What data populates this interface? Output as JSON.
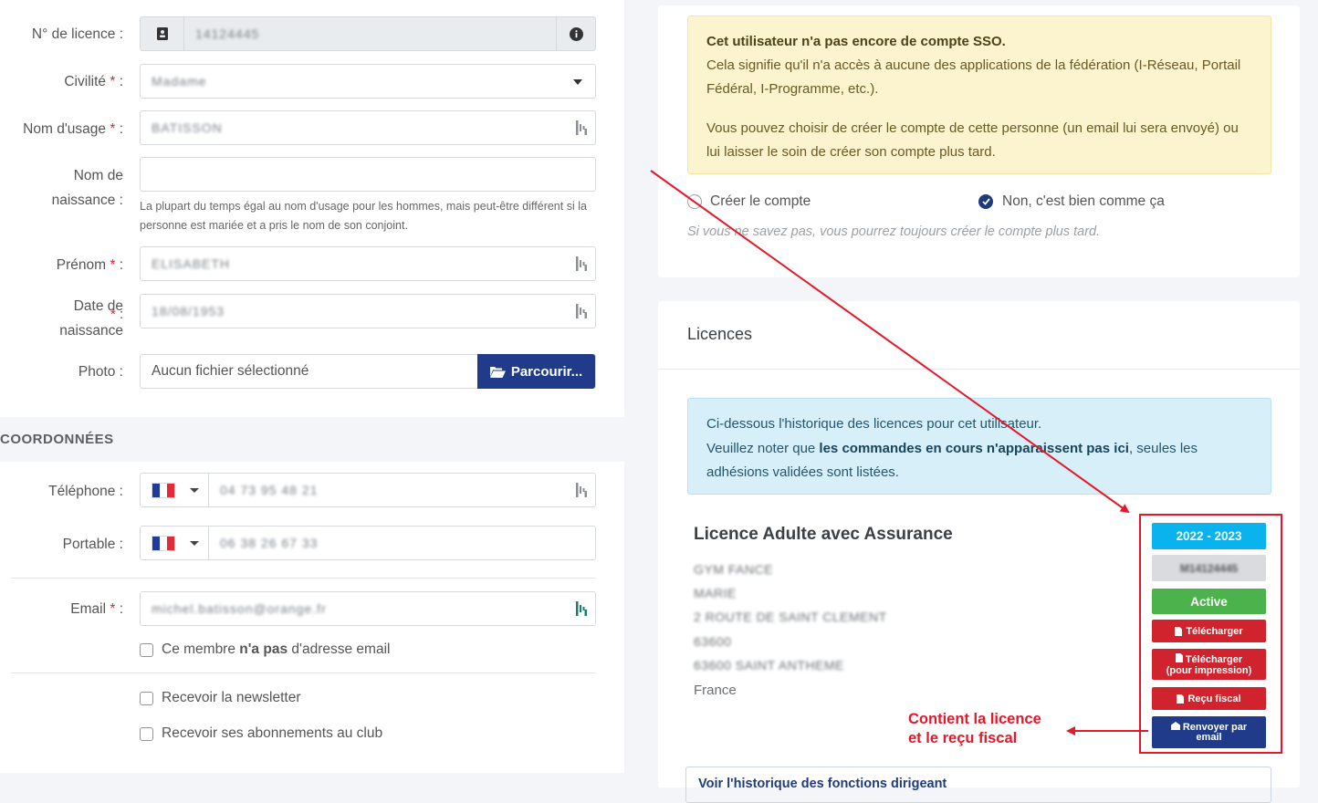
{
  "form": {
    "licence_label": "N° de licence :",
    "licence_value": "14124445",
    "civility_label": "Civilité",
    "civility_value": "Madame",
    "usage_name_label": "Nom d'usage",
    "usage_name_value": "BATISSON",
    "birth_name_label_1": "Nom de",
    "birth_name_label_2": "naissance :",
    "birth_name_help": "La plupart du temps égal au nom d'usage pour les hommes, mais peut-être différent si la personne est mariée et a pris le nom de son conjoint.",
    "firstname_label": "Prénom",
    "firstname_value": "ELISABETH",
    "birthdate_label_1": "Date de",
    "birthdate_label_2": "naissance",
    "birthdate_value": "18/08/1953",
    "photo_label": "Photo :",
    "photo_placeholder": "Aucun fichier sélectionné",
    "browse_label": "Parcourir...",
    "required_mark": "*",
    "colon": ":"
  },
  "contact": {
    "section_title": "COORDONNÉES",
    "phone_label": "Téléphone :",
    "phone_value": "04 73 95 48 21",
    "mobile_label": "Portable :",
    "mobile_value": "06 38 26 67 33",
    "email_label": "Email",
    "email_value": "michel.batisson@orange.fr",
    "no_email_pre": "Ce membre ",
    "no_email_bold": "n'a pas",
    "no_email_post": " d'adresse email",
    "newsletter_label": "Recevoir la newsletter",
    "subscriptions_label": "Recevoir ses abonnements au club"
  },
  "sso": {
    "title": "Cet utilisateur n'a pas encore de compte SSO.",
    "line1": "Cela signifie qu'il n'a accès à aucune des applications de la fédération (I-Réseau, Portail Fédéral, I-Programme, etc.).",
    "line2": "Vous pouvez choisir de créer le compte de cette personne (un email lui sera envoyé) ou lui laisser le soin de créer son compte plus tard.",
    "create_label": "Créer le compte",
    "keep_label": "Non, c'est bien comme ça",
    "hint": "Si vous ne savez pas, vous pourrez toujours créer le compte plus tard."
  },
  "licences": {
    "header": "Licences",
    "info_line1": "Ci-dessous l'historique des licences pour cet utilisateur.",
    "info_line2_pre": "Veuillez noter que ",
    "info_line2_bold": "les commandes en cours n'apparaissent pas ici",
    "info_line2_post": ", seules les adhésions validées sont listées.",
    "licence_title": "Licence Adulte avec Assurance",
    "address": [
      "GYM FANCE",
      "MARIE",
      "2 ROUTE DE SAINT CLEMENT",
      "63600",
      "63600 SAINT ANTHEME"
    ],
    "country": "France",
    "season": "2022 - 2023",
    "licence_number": "M14124445",
    "status": "Active",
    "download": "Télécharger",
    "download_print_1": "Télécharger",
    "download_print_2": "(pour impression)",
    "tax_receipt": "Reçu fiscal",
    "resend_1": "Renvoyer par",
    "resend_2": "email",
    "history_link": "Voir l'historique des fonctions dirigeant"
  },
  "annotation": {
    "line1": "Contient la licence",
    "line2": "et le reçu fiscal"
  },
  "colors": {
    "primary": "#1f3b8a",
    "season": "#0ab2ee",
    "active": "#4cb34c",
    "danger": "#d0232e",
    "annotation": "#e3182b"
  }
}
